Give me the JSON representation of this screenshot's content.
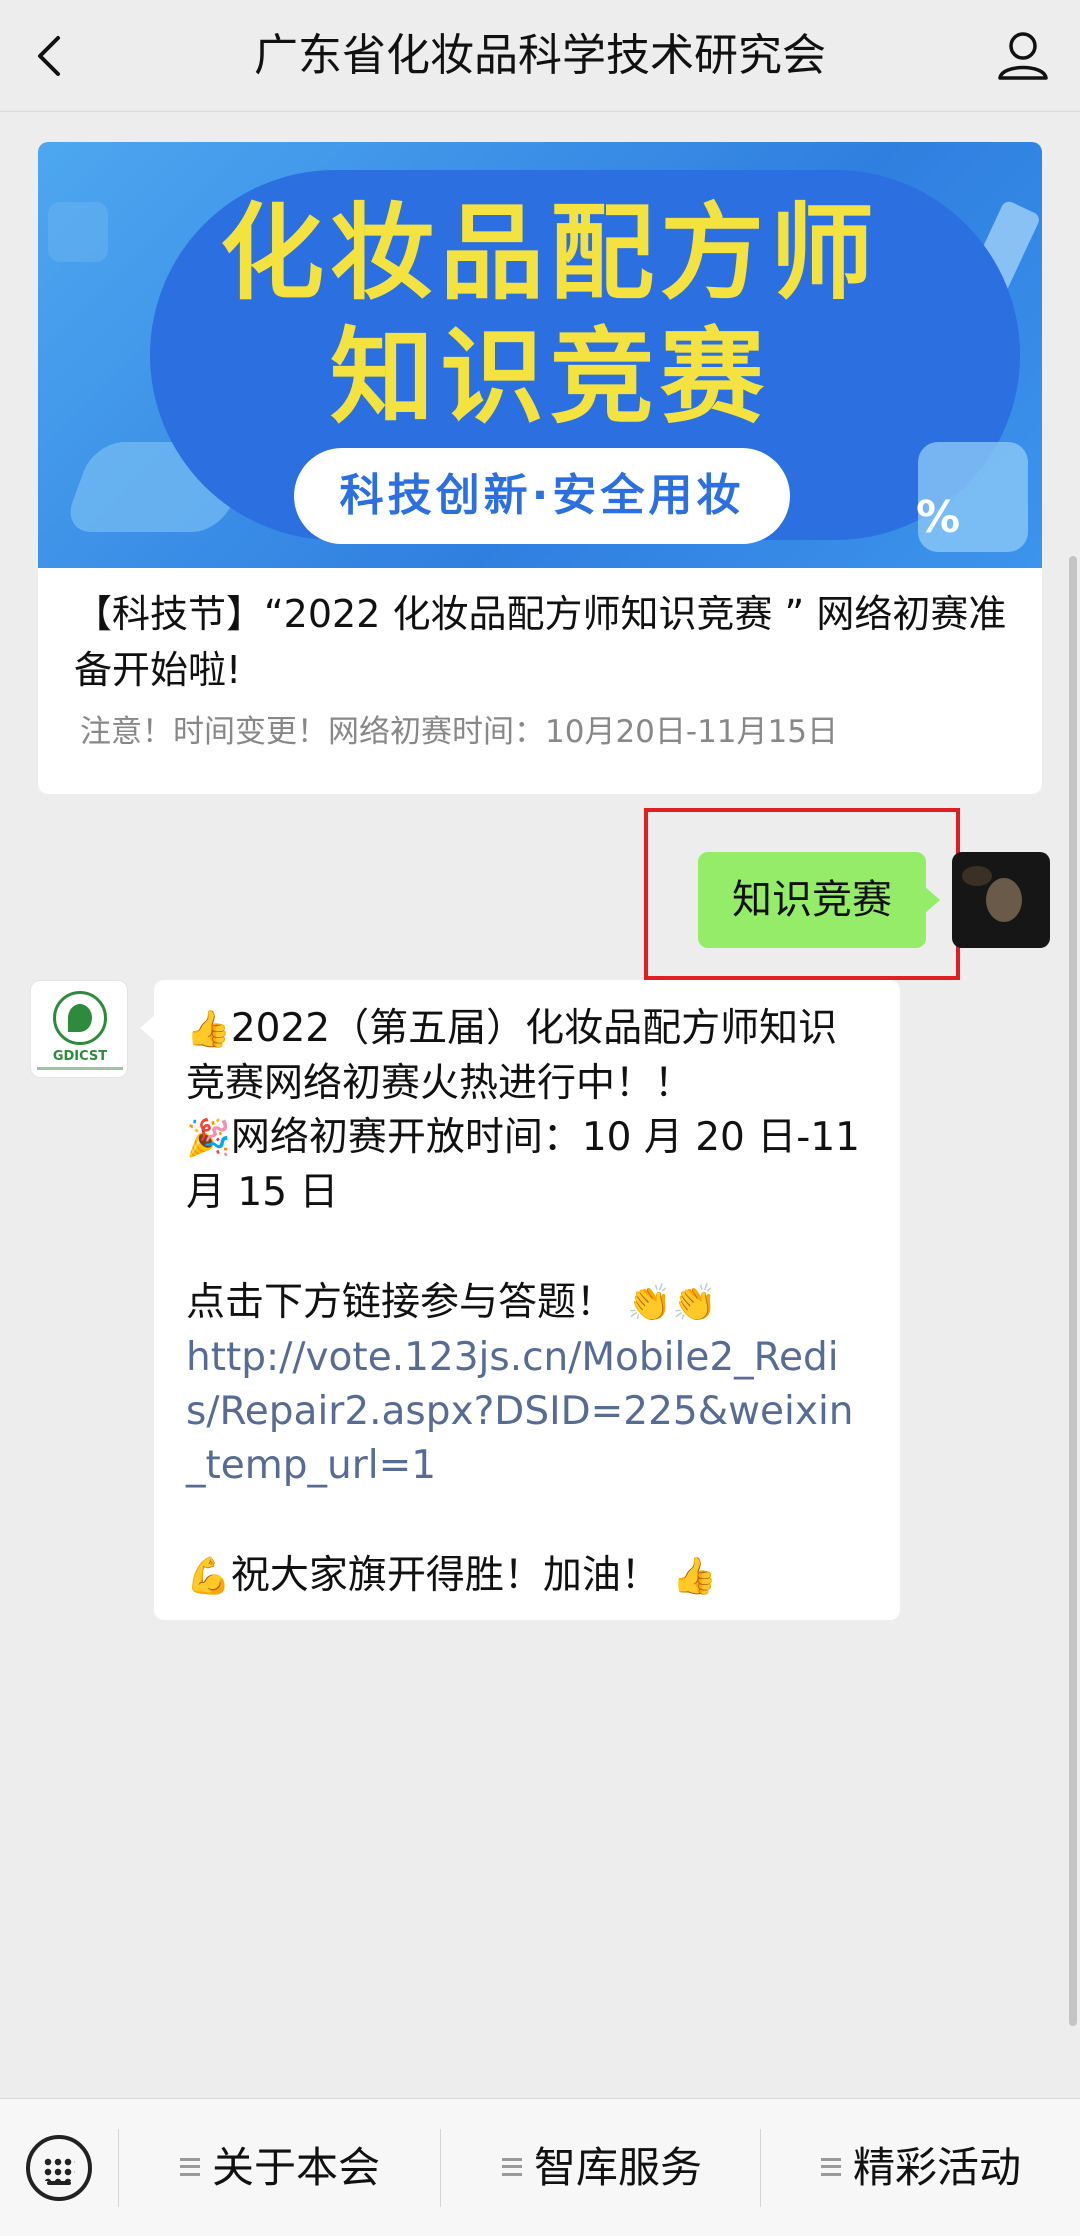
{
  "header": {
    "title": "广东省化妆品科学技术研究会",
    "back_icon": "chevron-left-icon",
    "profile_icon": "person-icon"
  },
  "article": {
    "banner": {
      "line1": "化妆品配方师",
      "line2": "知识竞赛",
      "slogan": "科技创新·安全用妆",
      "percent_symbol": "%"
    },
    "title": "【科技节】“2022 化妆品配方师知识竞赛 ” 网络初赛准备开始啦!",
    "description": "注意！时间变更！网络初赛时间：10月20日-11月15日"
  },
  "outgoing": {
    "text": "知识竞赛",
    "highlight_color": "#e02020",
    "bubble_color": "#95ec69"
  },
  "incoming": {
    "avatar_text": "GDICST",
    "line1": "2022（第五届）化妆品配方师知识竞赛网络初赛火热进行中！！",
    "line1_emoji": "👍",
    "line2": "网络初赛开放时间：10 月 20 日-11 月 15 日",
    "line2_emoji": "🎉",
    "line3": "点击下方链接参与答题！",
    "line3_emoji": "👏👏",
    "link": "http://vote.123js.cn/Mobile2_Redis/Repair2.aspx?DSID=225&weixin_temp_url=1",
    "line4": "祝大家旗开得胜！加油！",
    "line4_emoji_start": "💪",
    "line4_emoji_end": "👍",
    "link_color": "#576b95"
  },
  "bottom_menu": {
    "keyboard_icon": "keyboard-icon",
    "items": [
      {
        "label": "关于本会",
        "icon": "menu-icon"
      },
      {
        "label": "智库服务",
        "icon": "menu-icon"
      },
      {
        "label": "精彩活动",
        "icon": "menu-icon"
      }
    ]
  }
}
